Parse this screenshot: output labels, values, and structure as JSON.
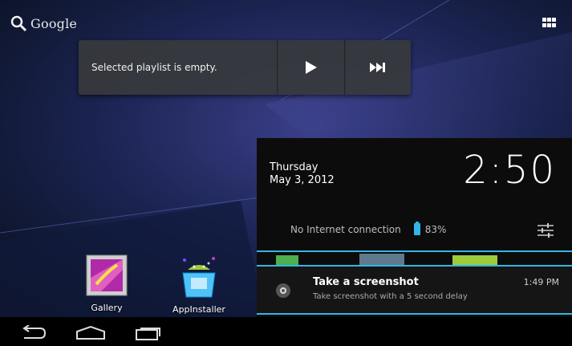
{
  "search": {
    "label": "Google"
  },
  "music_widget": {
    "message": "Selected playlist is empty."
  },
  "apps": [
    {
      "label": "Gallery",
      "icon": "gallery-icon"
    },
    {
      "label": "AppInstaller",
      "icon": "android-appinstaller-icon"
    }
  ],
  "notification_shade": {
    "day": "Thursday",
    "date": "May 3, 2012",
    "time": "2:50",
    "connection": "No Internet connection",
    "battery": "83%",
    "notification": {
      "title": "Take a screenshot",
      "subtitle": "Take screenshot with a 5 second delay",
      "time": "1:49 PM"
    }
  },
  "colors": {
    "accent": "#33b5e5",
    "shade_bg": "#0c0c0c",
    "widget_bg": "#37393c"
  },
  "navbar": {
    "buttons": [
      "back-icon",
      "home-icon",
      "recent-apps-icon"
    ]
  }
}
